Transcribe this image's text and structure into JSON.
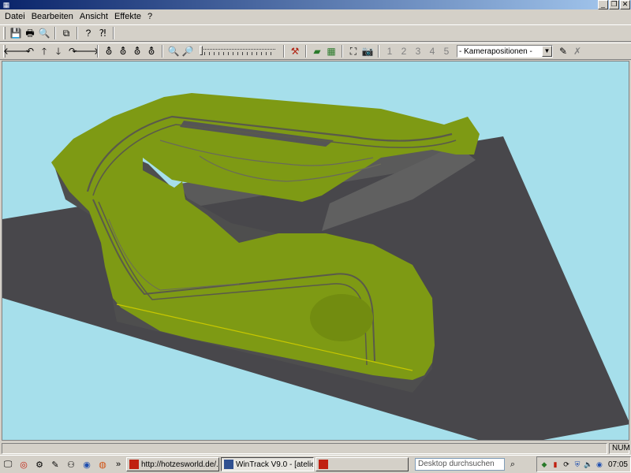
{
  "window": {
    "app_icon": "app-icon",
    "buttons": [
      "_",
      "❐",
      "✕"
    ]
  },
  "menu": [
    "Datei",
    "Bearbeiten",
    "Ansicht",
    "Effekte",
    "?"
  ],
  "toolbar1": {
    "icons": [
      "save-icon",
      "print-icon",
      "print-preview-icon",
      "copy-icon",
      "help-icon",
      "context-help-icon"
    ]
  },
  "toolbar2": {
    "camera_select": {
      "value": "- Kamerapositionen -"
    },
    "camera_presets": [
      "1",
      "2",
      "3",
      "4",
      "5"
    ]
  },
  "statusbar": {
    "main_text": "",
    "num": "NUM"
  },
  "taskbar": {
    "tasks": [
      {
        "label": "http://hotzesworld.de/...",
        "active": false
      },
      {
        "label": "WinTrack  V9.0 - [atelie...",
        "active": true
      },
      {
        "label": "",
        "active": false
      }
    ],
    "search_placeholder": "Desktop durchsuchen",
    "clock": "07:05"
  },
  "colors": {
    "sky": "#a6dfeb",
    "baseplate": "#48474b",
    "terrain": "#7e9a14",
    "cliff": "#5a5a5a",
    "title_gradient_start": "#0a246a"
  }
}
